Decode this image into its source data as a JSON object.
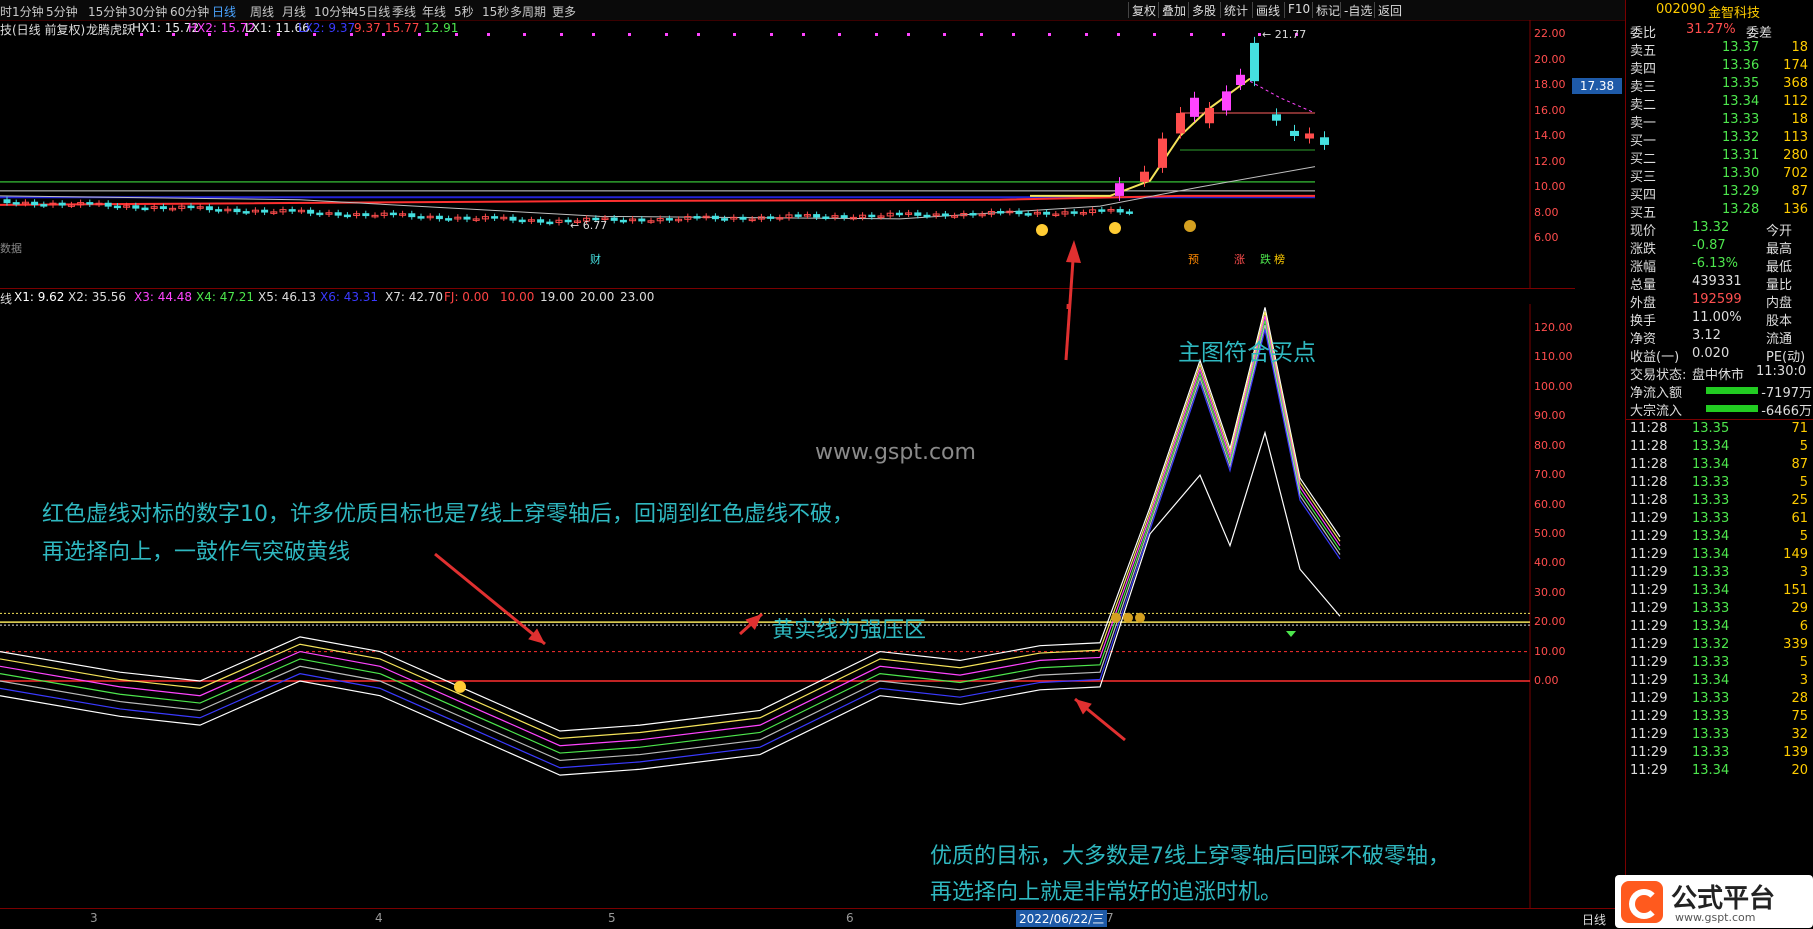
{
  "toolbar": {
    "timeframes": [
      "时",
      "1分钟",
      "5分钟",
      "15分钟",
      "30分钟",
      "60分钟",
      "日线",
      "周线",
      "月线",
      "10分钟",
      "45日线",
      "季线",
      "年线",
      "5秒",
      "15秒",
      "多周期",
      "更多"
    ],
    "active": "日线",
    "right_buttons": [
      "复权",
      "叠加",
      "多股",
      "统计",
      "画线",
      "F10",
      "标记",
      "-自选",
      "返回"
    ]
  },
  "main_chart": {
    "legend_title": "技(日线 前复权)",
    "indicator_name": "龙腾虎跃",
    "hx1": "HX1: 15.72",
    "hx2": "HX2: 15.72",
    "lx1": "LX1: 11.66",
    "lx2": "LX2: 9.37",
    "v1": "9.37",
    "v2": "15.77",
    "v3": "12.91",
    "high_label": "21.77",
    "low_label": "6.77",
    "price_marker": "17.38",
    "y_ticks": [
      "22.00",
      "20.00",
      "18.00",
      "16.00",
      "14.00",
      "12.00",
      "10.00",
      "8.00",
      "6.00"
    ],
    "data_label": "数据",
    "event_labels": [
      "财",
      "预",
      "涨",
      "跌",
      "榜"
    ]
  },
  "indicator2": {
    "name": "线",
    "x1": "X1: 9.62",
    "x2": "X2: 35.56",
    "x3": "X3: 44.48",
    "x4": "X4: 47.21",
    "x5": "X5: 46.13",
    "x6": "X6: 43.31",
    "x7": "X7: 42.70",
    "fj": "FJ: 0.00",
    "l1": "10.00",
    "l2": "19.00",
    "l3": "20.00",
    "l4": "23.00",
    "y_ticks": [
      "120.00",
      "110.00",
      "100.00",
      "90.00",
      "80.00",
      "70.00",
      "60.00",
      "50.00",
      "40.00",
      "30.00",
      "20.00",
      "10.00",
      "0.00"
    ]
  },
  "annotations": {
    "buy_point": "主图符合买点",
    "watermark": "www.gspt.com",
    "red_dash_line1": "红色虚线对标的数字10，许多优质目标也是7线上穿零轴后，回调到红色虚线不破，",
    "red_dash_line2": "再选择向上，一鼓作气突破黄线",
    "yellow_line": "黄实线为强压区",
    "quality_line1": "优质的目标，大多数是7线上穿零轴后回踩不破零轴，",
    "quality_line2": "再选择向上就是非常好的追涨时机。"
  },
  "x_axis": {
    "months": [
      "3",
      "4",
      "5",
      "6",
      "7"
    ],
    "date": "2022/06/22/三",
    "right_label": "日线"
  },
  "quote": {
    "code": "002090",
    "name": "金智科技",
    "weibi_label": "委比",
    "weibi_value": "31.27%",
    "weicha_label": "委差",
    "asks": [
      {
        "label": "卖五",
        "price": "13.37",
        "vol": "18"
      },
      {
        "label": "卖四",
        "price": "13.36",
        "vol": "174"
      },
      {
        "label": "卖三",
        "price": "13.35",
        "vol": "368"
      },
      {
        "label": "卖二",
        "price": "13.34",
        "vol": "112"
      },
      {
        "label": "卖一",
        "price": "13.33",
        "vol": "18"
      }
    ],
    "bids": [
      {
        "label": "买一",
        "price": "13.32",
        "vol": "113"
      },
      {
        "label": "买二",
        "price": "13.31",
        "vol": "280"
      },
      {
        "label": "买三",
        "price": "13.30",
        "vol": "702"
      },
      {
        "label": "买四",
        "price": "13.29",
        "vol": "87"
      },
      {
        "label": "买五",
        "price": "13.28",
        "vol": "136"
      }
    ],
    "stats": [
      {
        "l": "现价",
        "v": "13.32",
        "r": "今开",
        "c": "#4de64d"
      },
      {
        "l": "涨跌",
        "v": "-0.87",
        "r": "最高",
        "c": "#4de64d"
      },
      {
        "l": "涨幅",
        "v": "-6.13%",
        "r": "最低",
        "c": "#4de64d"
      },
      {
        "l": "总量",
        "v": "439331",
        "r": "量比",
        "c": "#ddd"
      },
      {
        "l": "外盘",
        "v": "192599",
        "r": "内盘",
        "c": "#ff5050"
      },
      {
        "l": "换手",
        "v": "11.00%",
        "r": "股本",
        "c": "#ddd"
      },
      {
        "l": "净资",
        "v": "3.12",
        "r": "流通",
        "c": "#ddd"
      },
      {
        "l": "收益(一)",
        "v": "0.020",
        "r": "PE(动)",
        "c": "#ddd"
      }
    ],
    "status_label": "交易状态:",
    "status_value": "盘中休市",
    "status_time": "11:30:0",
    "netflow_label": "净流入额",
    "netflow_value": "-7197万",
    "bigflow_label": "大宗流入",
    "bigflow_value": "-6466万",
    "ticks": [
      {
        "t": "11:28",
        "p": "13.35",
        "v": "71"
      },
      {
        "t": "11:28",
        "p": "13.34",
        "v": "5"
      },
      {
        "t": "11:28",
        "p": "13.34",
        "v": "87"
      },
      {
        "t": "11:28",
        "p": "13.33",
        "v": "5"
      },
      {
        "t": "11:28",
        "p": "13.33",
        "v": "25"
      },
      {
        "t": "11:29",
        "p": "13.33",
        "v": "61"
      },
      {
        "t": "11:29",
        "p": "13.34",
        "v": "5"
      },
      {
        "t": "11:29",
        "p": "13.34",
        "v": "149"
      },
      {
        "t": "11:29",
        "p": "13.33",
        "v": "3"
      },
      {
        "t": "11:29",
        "p": "13.34",
        "v": "151"
      },
      {
        "t": "11:29",
        "p": "13.33",
        "v": "29"
      },
      {
        "t": "11:29",
        "p": "13.34",
        "v": "6"
      },
      {
        "t": "11:29",
        "p": "13.32",
        "v": "339"
      },
      {
        "t": "11:29",
        "p": "13.33",
        "v": "5"
      },
      {
        "t": "11:29",
        "p": "13.34",
        "v": "3"
      },
      {
        "t": "11:29",
        "p": "13.33",
        "v": "28"
      },
      {
        "t": "11:29",
        "p": "13.33",
        "v": "75"
      },
      {
        "t": "11:29",
        "p": "13.33",
        "v": "32"
      },
      {
        "t": "11:29",
        "p": "13.33",
        "v": "139"
      },
      {
        "t": "11:29",
        "p": "13.34",
        "v": "20"
      }
    ]
  },
  "logo": {
    "text": "公式平台",
    "url": "www.gspt.com"
  }
}
